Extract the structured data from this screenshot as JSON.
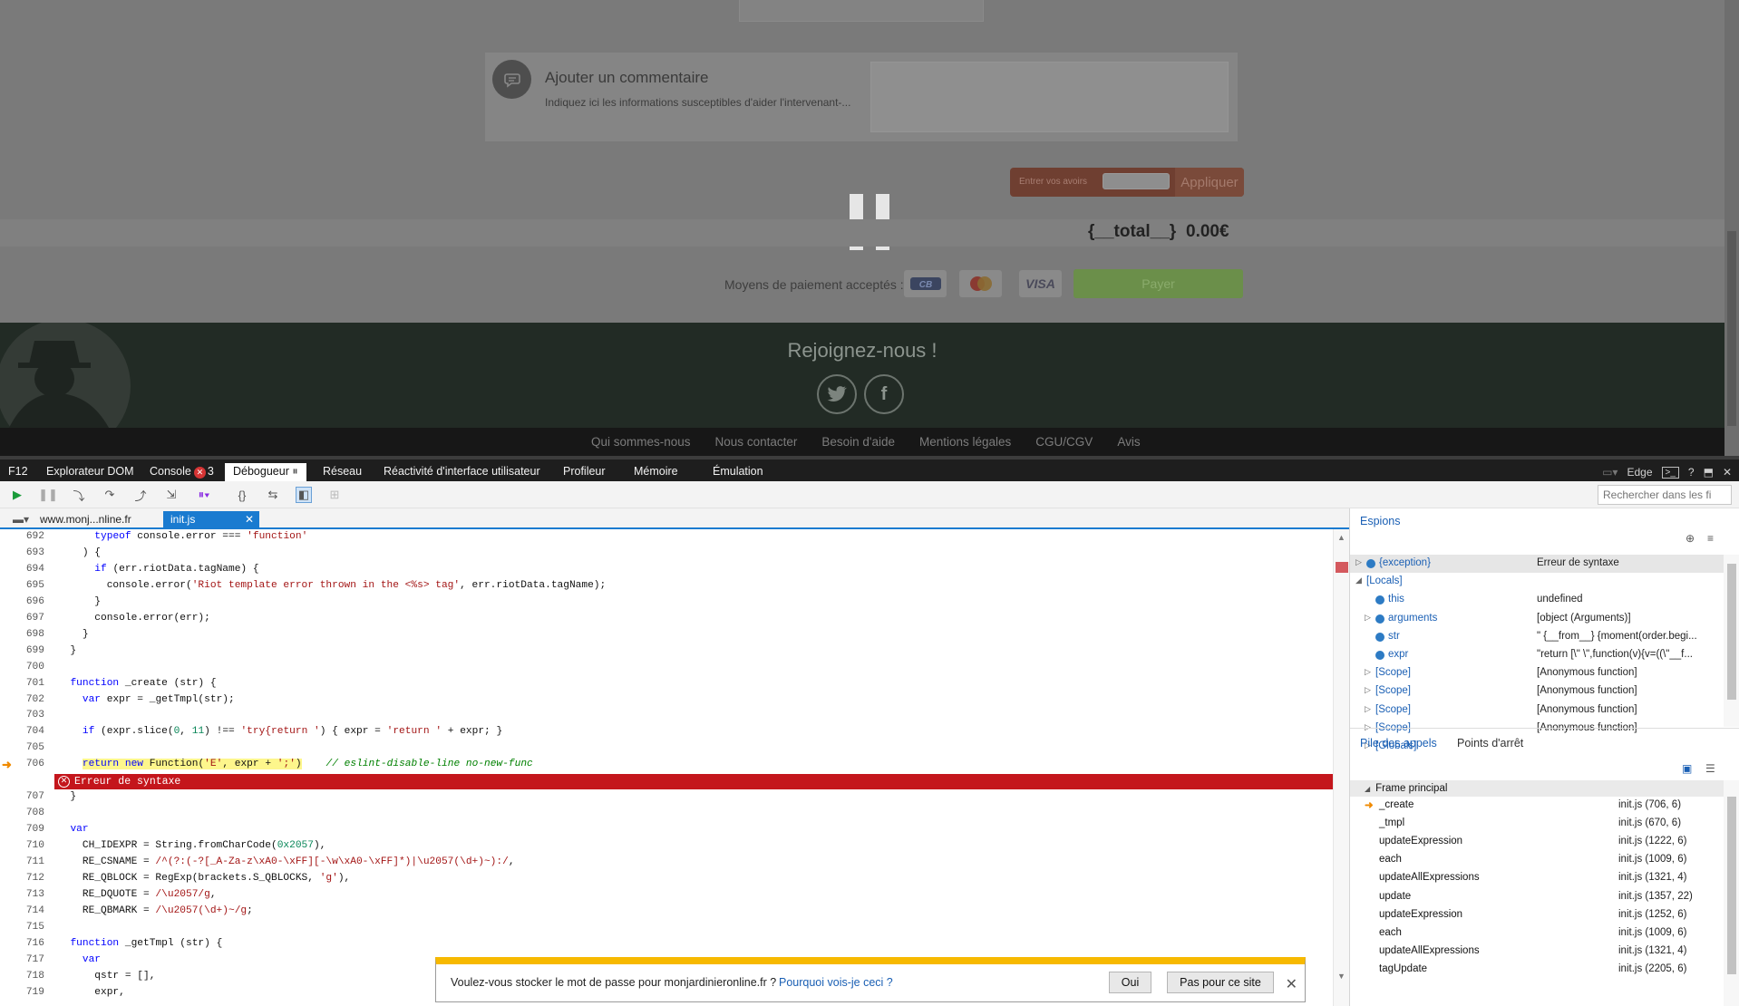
{
  "page": {
    "comment": {
      "title": "Ajouter un commentaire",
      "hint": "Indiquez ici les informations susceptibles d'aider l'intervenant-..."
    },
    "voucher": {
      "label": "Entrer vos avoirs",
      "apply": "Appliquer"
    },
    "total": {
      "label": "{__total__}",
      "value": "0.00€"
    },
    "payment": {
      "label": "Moyens de paiement acceptés :",
      "cards": [
        "CB",
        "MasterCard",
        "VISA"
      ],
      "pay_button": "Payer"
    },
    "footer": {
      "join": "Rejoignez-nous !",
      "social": [
        "twitter",
        "facebook"
      ],
      "links": [
        "Qui sommes-nous",
        "Nous contacter",
        "Besoin d'aide",
        "Mentions légales",
        "CGU/CGV",
        "Avis"
      ]
    }
  },
  "devtools": {
    "tabs": [
      {
        "label": "F12"
      },
      {
        "label": "Explorateur DOM"
      },
      {
        "label": "Console",
        "badge": "3"
      },
      {
        "label": "Débogueur",
        "active": true
      },
      {
        "label": "Réseau"
      },
      {
        "label": "Réactivité d'interface utilisateur"
      },
      {
        "label": "Profileur"
      },
      {
        "label": "Mémoire"
      },
      {
        "label": "Émulation"
      }
    ],
    "browser_mode": "Edge",
    "search_placeholder": "Rechercher dans les fi",
    "documents": [
      {
        "label": "www.monj...nline.fr",
        "active": false
      },
      {
        "label": "init.js",
        "active": true
      }
    ],
    "code_lines": [
      {
        "n": "692",
        "html": "      <span class=\"kw\">typeof</span> console.error === <span class=\"str\">'function'</span>"
      },
      {
        "n": "693",
        "html": "    ) {"
      },
      {
        "n": "694",
        "html": "      <span class=\"kw\">if</span> (err.riotData.tagName) {"
      },
      {
        "n": "695",
        "html": "        console.error(<span class=\"str\">'Riot template error thrown in the &lt;%s&gt; tag'</span>, err.riotData.tagName);"
      },
      {
        "n": "696",
        "html": "      }"
      },
      {
        "n": "697",
        "html": "      console.error(err);"
      },
      {
        "n": "698",
        "html": "    }"
      },
      {
        "n": "699",
        "html": "  }"
      },
      {
        "n": "700",
        "html": ""
      },
      {
        "n": "701",
        "html": "  <span class=\"kw\">function</span> _create (str) {"
      },
      {
        "n": "702",
        "html": "    <span class=\"kw\">var</span> expr = _getTmpl(str);"
      },
      {
        "n": "703",
        "html": ""
      },
      {
        "n": "704",
        "html": "    <span class=\"kw\">if</span> (expr.slice(<span class=\"num\">0</span>, <span class=\"num\">11</span>) !== <span class=\"str\">'try{return '</span>) { expr = <span class=\"str\">'return '</span> + expr; }"
      },
      {
        "n": "705",
        "html": ""
      },
      {
        "n": "706",
        "html": "    <span class=\"hl\"><span class=\"kw\">return</span> <span class=\"kw\">new</span> Function(<span class=\"str\">'E'</span>, expr + <span class=\"str\">';'</span>)</span>    <span class=\"cmt\">// eslint-disable-line no-new-func</span>",
        "current": true
      },
      {
        "n": "",
        "error": "Erreur de syntaxe"
      },
      {
        "n": "707",
        "html": "  }"
      },
      {
        "n": "708",
        "html": ""
      },
      {
        "n": "709",
        "html": "  <span class=\"kw\">var</span>"
      },
      {
        "n": "710",
        "html": "    CH_IDEXPR = String.fromCharCode(<span class=\"num\">0x2057</span>),"
      },
      {
        "n": "711",
        "html": "    RE_CSNAME = <span class=\"re\">/^(?:(-?[_A-Za-z\\xA0-\\xFF][-\\w\\xA0-\\xFF]*)|\\u2057(\\d+)~):/</span>,"
      },
      {
        "n": "712",
        "html": "    RE_QBLOCK = RegExp(brackets.S_QBLOCKS, <span class=\"str\">'g'</span>),"
      },
      {
        "n": "713",
        "html": "    RE_DQUOTE = <span class=\"re\">/\\u2057/g</span>,"
      },
      {
        "n": "714",
        "html": "    RE_QBMARK = <span class=\"re\">/\\u2057(\\d+)~/g</span>;"
      },
      {
        "n": "715",
        "html": ""
      },
      {
        "n": "716",
        "html": "  <span class=\"kw\">function</span> _getTmpl (str) {"
      },
      {
        "n": "717",
        "html": "    <span class=\"kw\">var</span>"
      },
      {
        "n": "718",
        "html": "      qstr = [],"
      },
      {
        "n": "719",
        "html": "      expr,"
      }
    ],
    "watches": {
      "title": "Espions",
      "rows": [
        {
          "name": "{exception}",
          "value": "Erreur de syntaxe",
          "indent": 0,
          "expand": "closed",
          "dot": true,
          "selected": true
        },
        {
          "name": "[Locals]",
          "value": "",
          "indent": 0,
          "expand": "open",
          "dot": false
        },
        {
          "name": "this",
          "value": "undefined",
          "indent": 1,
          "expand": "",
          "dot": true
        },
        {
          "name": "arguments",
          "value": "[object (Arguments)]",
          "indent": 1,
          "expand": "closed",
          "dot": true
        },
        {
          "name": "str",
          "value": "\" {__from__} {moment(order.begi...",
          "indent": 1,
          "expand": "",
          "dot": true
        },
        {
          "name": "expr",
          "value": "\"return [\\\" \\\",function(v){v=((\\\"__f...",
          "indent": 1,
          "expand": "",
          "dot": true
        },
        {
          "name": "[Scope]",
          "value": "[Anonymous function]",
          "indent": 1,
          "expand": "closed",
          "dot": false
        },
        {
          "name": "[Scope]",
          "value": "[Anonymous function]",
          "indent": 1,
          "expand": "closed",
          "dot": false
        },
        {
          "name": "[Scope]",
          "value": "[Anonymous function]",
          "indent": 1,
          "expand": "closed",
          "dot": false
        },
        {
          "name": "[Scope]",
          "value": "[Anonymous function]",
          "indent": 1,
          "expand": "closed",
          "dot": false
        },
        {
          "name": "[Globals]",
          "value": "",
          "indent": 1,
          "expand": "closed",
          "dot": false
        }
      ]
    },
    "callstack": {
      "tabs": [
        "Pile des appels",
        "Points d'arrêt"
      ],
      "frame": "Frame principal",
      "rows": [
        {
          "fn": "_create",
          "loc": "init.js (706, 6)",
          "current": true
        },
        {
          "fn": "_tmpl",
          "loc": "init.js (670, 6)"
        },
        {
          "fn": "updateExpression",
          "loc": "init.js (1222, 6)"
        },
        {
          "fn": "each",
          "loc": "init.js (1009, 6)"
        },
        {
          "fn": "updateAllExpressions",
          "loc": "init.js (1321, 4)"
        },
        {
          "fn": "update",
          "loc": "init.js (1357, 22)"
        },
        {
          "fn": "updateExpression",
          "loc": "init.js (1252, 6)"
        },
        {
          "fn": "each",
          "loc": "init.js (1009, 6)"
        },
        {
          "fn": "updateAllExpressions",
          "loc": "init.js (1321, 4)"
        },
        {
          "fn": "tagUpdate",
          "loc": "init.js (2205, 6)"
        }
      ]
    },
    "password_prompt": {
      "question": "Voulez-vous stocker le mot de passe pour monjardinieronline.fr ?",
      "why": "Pourquoi vois-je ceci ?",
      "yes": "Oui",
      "no": "Pas pour ce site"
    }
  }
}
